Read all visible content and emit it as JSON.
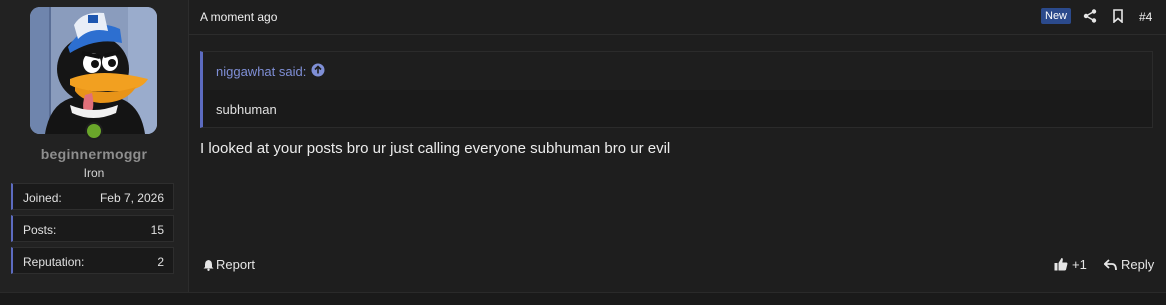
{
  "author": {
    "username": "beginnermoggr",
    "rank": "Iron",
    "stats": [
      {
        "label": "Joined:",
        "value": "Feb 7, 2026"
      },
      {
        "label": "Posts:",
        "value": "15"
      },
      {
        "label": "Reputation:",
        "value": "2"
      }
    ],
    "online_color": "#6aa62a"
  },
  "header": {
    "timestamp": "A moment ago",
    "new_badge": "New",
    "post_number": "#4"
  },
  "quote": {
    "author_line": "niggawhat said:",
    "text": "subhuman"
  },
  "message": "I looked at your posts bro ur just calling everyone subhuman bro ur evil",
  "footer": {
    "report_label": "Report",
    "like_label": "+1",
    "reply_label": "Reply"
  },
  "colors": {
    "accent": "#5c6bc0",
    "quote_author": "#7f8fd6",
    "badge": "#2b4a8c"
  },
  "icons": [
    "share-icon",
    "bookmark-icon",
    "circle-arrow-up-icon",
    "bell-icon",
    "thumbs-up-icon",
    "reply-arrow-icon"
  ]
}
